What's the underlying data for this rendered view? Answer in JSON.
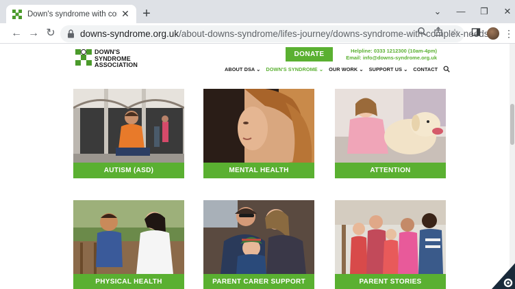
{
  "browser": {
    "tab_title": "Down's syndrome with complex nee",
    "url_domain": "downs-syndrome.org.uk",
    "url_path": "/about-downs-syndrome/lifes-journey/downs-syndrome-with-complex-needs/"
  },
  "site": {
    "logo_line1": "DOWN'S",
    "logo_line2": "SYNDROME",
    "logo_line3": "ASSOCIATION",
    "donate_label": "DONATE",
    "helpline": "Helpline: 0333 1212300 (10am-4pm)",
    "email": "Email: info@downs-syndrome.org.uk",
    "nav": [
      {
        "label": "ABOUT DSA ⌄"
      },
      {
        "label": "DOWN'S SYNDROME ⌄"
      },
      {
        "label": "OUR WORK ⌄"
      },
      {
        "label": "SUPPORT US ⌄"
      },
      {
        "label": "CONTACT"
      }
    ],
    "brand_green": "#5ab031"
  },
  "cards": [
    {
      "label": "AUTISM (ASD)"
    },
    {
      "label": "MENTAL HEALTH"
    },
    {
      "label": "ATTENTION"
    },
    {
      "label": "PHYSICAL HEALTH"
    },
    {
      "label": "PARENT CARER SUPPORT"
    },
    {
      "label": "PARENT STORIES"
    }
  ]
}
